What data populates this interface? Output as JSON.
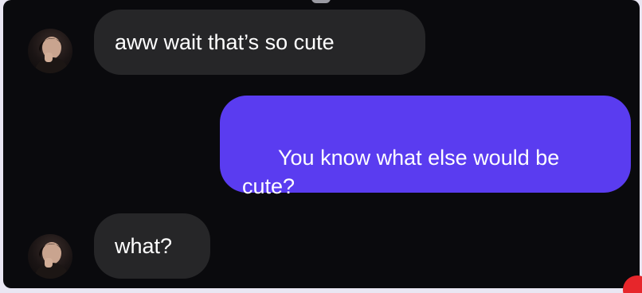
{
  "conversation": {
    "messages": [
      {
        "sender": "them",
        "text": "aww wait that’s so cute"
      },
      {
        "sender": "me",
        "text": "You know what else would be cute?"
      },
      {
        "sender": "them",
        "text": "what?"
      }
    ]
  },
  "colors": {
    "background": "#0a0a0d",
    "incoming_bubble": "#262628",
    "outgoing_bubble": "#5a3cf0",
    "text": "#ffffff",
    "notification_dot": "#e7262b"
  },
  "icons": {
    "avatar": "contact-avatar-photo",
    "notification": "red-dot"
  }
}
